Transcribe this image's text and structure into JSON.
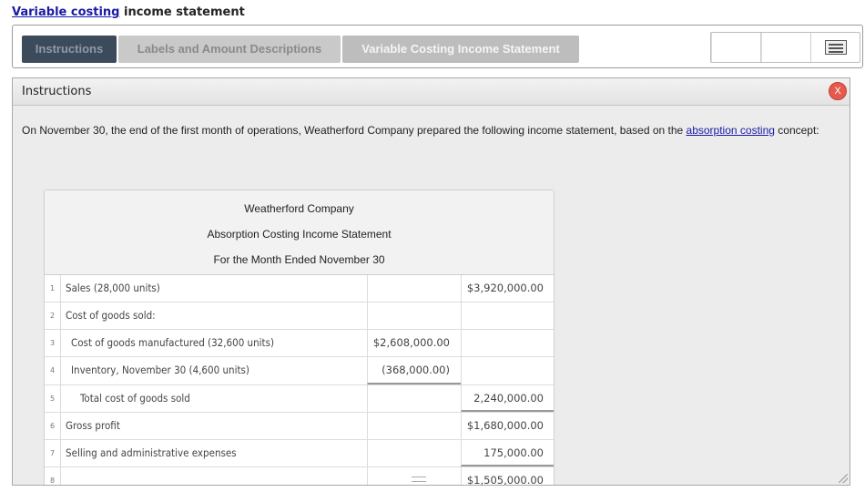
{
  "heading": {
    "link": "Variable costing",
    "rest": " income statement"
  },
  "tabs": [
    {
      "label": "Instructions"
    },
    {
      "label": "Labels and Amount Descriptions"
    },
    {
      "label": "Variable Costing Income Statement"
    }
  ],
  "panel": {
    "title": "Instructions",
    "close_label": "X",
    "intro_before": "On November 30, the end of the first month of operations, Weatherford Company prepared the following income statement, based on the ",
    "intro_link": "absorption costing",
    "intro_after": " concept:"
  },
  "statement": {
    "company": "Weatherford Company",
    "title": "Absorption Costing Income Statement",
    "period": "For the Month Ended November 30",
    "rows": [
      {
        "num": "1",
        "label": "Sales (28,000 units)",
        "col1": "",
        "col2": "$3,920,000.00"
      },
      {
        "num": "2",
        "label": "Cost of goods sold:",
        "col1": "",
        "col2": ""
      },
      {
        "num": "3",
        "label": "Cost of goods manufactured (32,600 units)",
        "col1": "$2,608,000.00",
        "col2": ""
      },
      {
        "num": "4",
        "label": "Inventory, November 30 (4,600 units)",
        "col1": "(368,000.00)",
        "col2": ""
      },
      {
        "num": "5",
        "label": "Total cost of goods sold",
        "col1": "",
        "col2": "2,240,000.00"
      },
      {
        "num": "6",
        "label": "Gross profit",
        "col1": "",
        "col2": "$1,680,000.00"
      },
      {
        "num": "7",
        "label": "Selling and administrative expenses",
        "col1": "",
        "col2": "175,000.00"
      },
      {
        "num": "8",
        "label": "",
        "col1": "",
        "col2": "$1,505,000.00"
      }
    ]
  }
}
